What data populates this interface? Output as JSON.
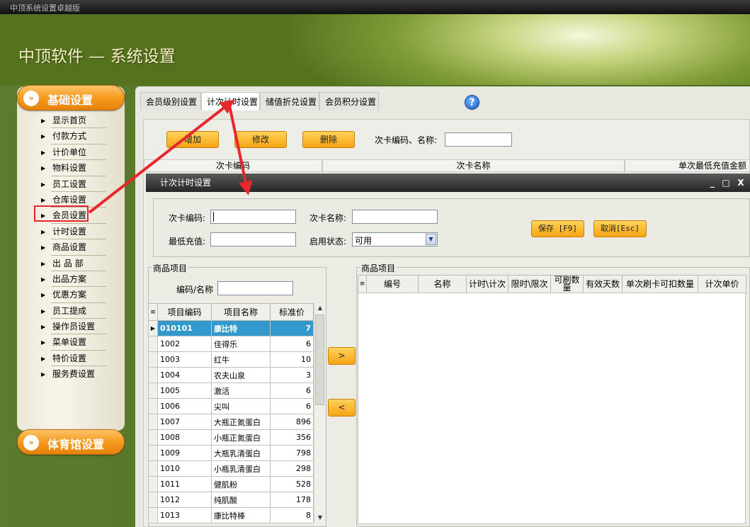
{
  "window": {
    "title": "中顶系统设置卓越版"
  },
  "banner": {
    "brand": "中顶软件 — 系统设置"
  },
  "sidebar": {
    "section1": "基础设置",
    "section2": "体育馆设置",
    "items": [
      "显示首页",
      "付款方式",
      "计价单位",
      "物料设置",
      "员工设置",
      "仓库设置",
      "会员设置",
      "计时设置",
      "商品设置",
      "出 品 部",
      "出品方案",
      "优惠方案",
      "员工提成",
      "操作员设置",
      "菜单设置",
      "特价设置",
      "服务费设置"
    ],
    "highlighted": "会员设置"
  },
  "tabs": [
    "会员级别设置",
    "计次计时设置",
    "储值折兑设置",
    "会员积分设置"
  ],
  "active_tab": "计次计时设置",
  "toolbar": {
    "add": "增加",
    "edit": "修改",
    "delete": "删除",
    "search_label": "次卡编码、名称:",
    "search_value": ""
  },
  "bg_grid": {
    "columns": [
      "次卡编码",
      "次卡名称",
      "单次最低充值金额"
    ]
  },
  "dialog": {
    "title": "计次计时设置",
    "controls": [
      "_",
      "□",
      "X"
    ],
    "code_label": "次卡编码:",
    "code_value": "",
    "name_label": "次卡名称:",
    "name_value": "",
    "min_label": "最低充值:",
    "min_value": "",
    "status_label": "启用状态:",
    "status_value": "可用",
    "save": "保存 [F9]",
    "cancel": "取消[Esc]"
  },
  "left_group": {
    "title": "商品项目",
    "filter_label": "编码/名称",
    "filter_value": "",
    "columns": [
      "项目编码",
      "项目名称",
      "标准价"
    ],
    "rows": [
      [
        "010101",
        "康比特",
        "7"
      ],
      [
        "1002",
        "佳得乐",
        "6"
      ],
      [
        "1003",
        "红牛",
        "10"
      ],
      [
        "1004",
        "农夫山泉",
        "3"
      ],
      [
        "1005",
        "激活",
        "6"
      ],
      [
        "1006",
        "尖叫",
        "6"
      ],
      [
        "1007",
        "大瓶正氮蛋白",
        "896"
      ],
      [
        "1008",
        "小瓶正氮蛋白",
        "356"
      ],
      [
        "1009",
        "大瓶乳清蛋白",
        "798"
      ],
      [
        "1010",
        "小瓶乳清蛋白",
        "298"
      ],
      [
        "1011",
        "健肌粉",
        "528"
      ],
      [
        "1012",
        "纯肌酸",
        "178"
      ],
      [
        "1013",
        "康比特棒",
        "8"
      ]
    ]
  },
  "transfer": {
    "add": ">",
    "remove": "<"
  },
  "right_group": {
    "title": "商品项目",
    "columns": [
      "编号",
      "名称",
      "计时\\计次",
      "限时\\限次",
      "可刷数量",
      "有效天数",
      "单次刷卡可扣数量",
      "计次单价"
    ]
  },
  "colors": {
    "accent_orange": "#f6a414",
    "selection": "#3399cc",
    "annotation_red": "#e8282e"
  }
}
